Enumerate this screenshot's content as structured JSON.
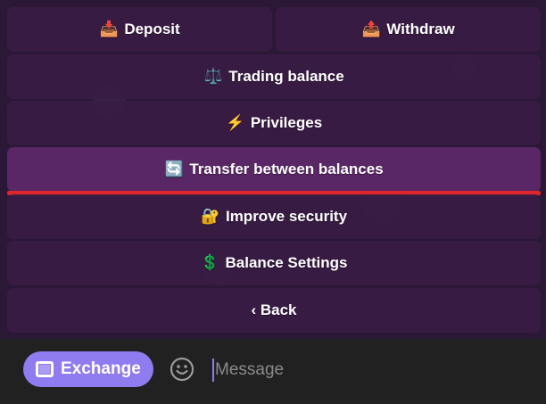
{
  "keyboard": {
    "deposit": {
      "icon": "inbox-tray-icon",
      "emoji": "📥",
      "label": "Deposit"
    },
    "withdraw": {
      "icon": "outbox-tray-icon",
      "emoji": "📤",
      "label": "Withdraw"
    },
    "trading_balance": {
      "icon": "balance-scale-icon",
      "emoji": "⚖️",
      "label": "Trading balance"
    },
    "privileges": {
      "icon": "lightning-icon",
      "emoji": "⚡",
      "label": "Privileges"
    },
    "transfer": {
      "icon": "refresh-arrows-icon",
      "emoji": "🔄",
      "label": "Transfer between balances"
    },
    "security": {
      "icon": "lock-icon",
      "emoji": "🔐",
      "label": "Improve security"
    },
    "balance_settings": {
      "icon": "dollar-icon",
      "emoji": "💲",
      "label": "Balance Settings"
    },
    "back": {
      "label": "‹ Back"
    }
  },
  "footer": {
    "exchange_label": "Exchange",
    "message_placeholder": "Message"
  },
  "colors": {
    "button_bg": "#3a1c44",
    "active_button_bg": "#5c2868",
    "underline": "#e0262a",
    "exchange_bg": "#8e7cf0",
    "footer_bg": "#212121"
  }
}
